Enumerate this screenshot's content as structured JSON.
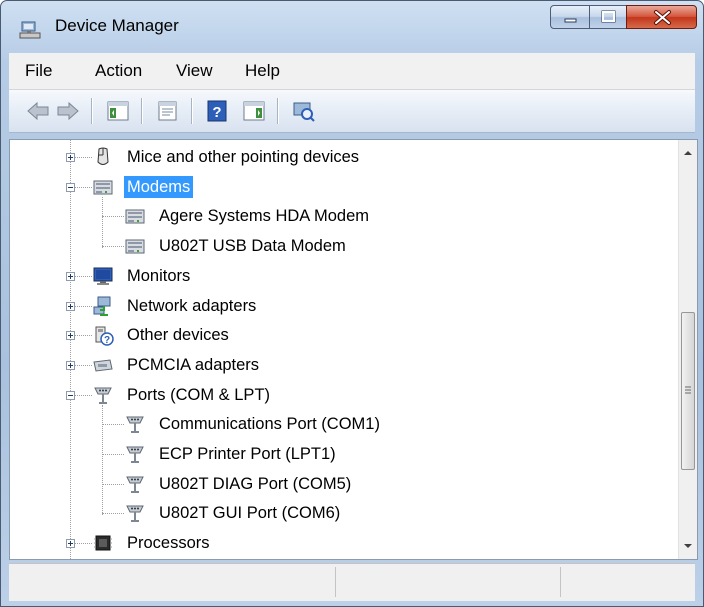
{
  "window": {
    "title": "Device Manager",
    "title_icon": "device-manager-icon"
  },
  "controls": {
    "minimize": "minimize-icon",
    "maximize": "maximize-icon",
    "close": "close-icon"
  },
  "menu": {
    "items": [
      "File",
      "Action",
      "View",
      "Help"
    ]
  },
  "toolbar": {
    "buttons": [
      "back-arrow-icon",
      "forward-arrow-icon",
      "show-hide-console-tree-icon",
      "properties-icon",
      "help-icon",
      "action-pane-icon",
      "scan-hardware-icon"
    ]
  },
  "tree": {
    "items": [
      {
        "label": "Mice and other pointing devices",
        "icon": "mouse-icon",
        "level": 0,
        "expander": "plus"
      },
      {
        "label": "Modems",
        "icon": "modem-icon",
        "level": 0,
        "expander": "minus",
        "selected": true
      },
      {
        "label": "Agere Systems HDA Modem",
        "icon": "modem-icon",
        "level": 1
      },
      {
        "label": "U802T USB Data Modem",
        "icon": "modem-icon",
        "level": 1
      },
      {
        "label": "Monitors",
        "icon": "monitor-icon",
        "level": 0,
        "expander": "plus"
      },
      {
        "label": "Network adapters",
        "icon": "network-adapter-icon",
        "level": 0,
        "expander": "plus"
      },
      {
        "label": "Other devices",
        "icon": "unknown-device-icon",
        "level": 0,
        "expander": "plus"
      },
      {
        "label": "PCMCIA adapters",
        "icon": "pcmcia-icon",
        "level": 0,
        "expander": "plus"
      },
      {
        "label": "Ports (COM & LPT)",
        "icon": "port-icon",
        "level": 0,
        "expander": "minus"
      },
      {
        "label": "Communications Port (COM1)",
        "icon": "port-icon",
        "level": 1
      },
      {
        "label": "ECP Printer Port (LPT1)",
        "icon": "port-icon",
        "level": 1
      },
      {
        "label": "U802T DIAG Port (COM5)",
        "icon": "port-icon",
        "level": 1
      },
      {
        "label": "U802T GUI Port (COM6)",
        "icon": "port-icon",
        "level": 1
      },
      {
        "label": "Processors",
        "icon": "processor-icon",
        "level": 0,
        "expander": "plus"
      }
    ]
  },
  "scrollbar": {
    "position": 0.55
  },
  "status": {
    "panes": [
      "",
      "",
      ""
    ]
  }
}
